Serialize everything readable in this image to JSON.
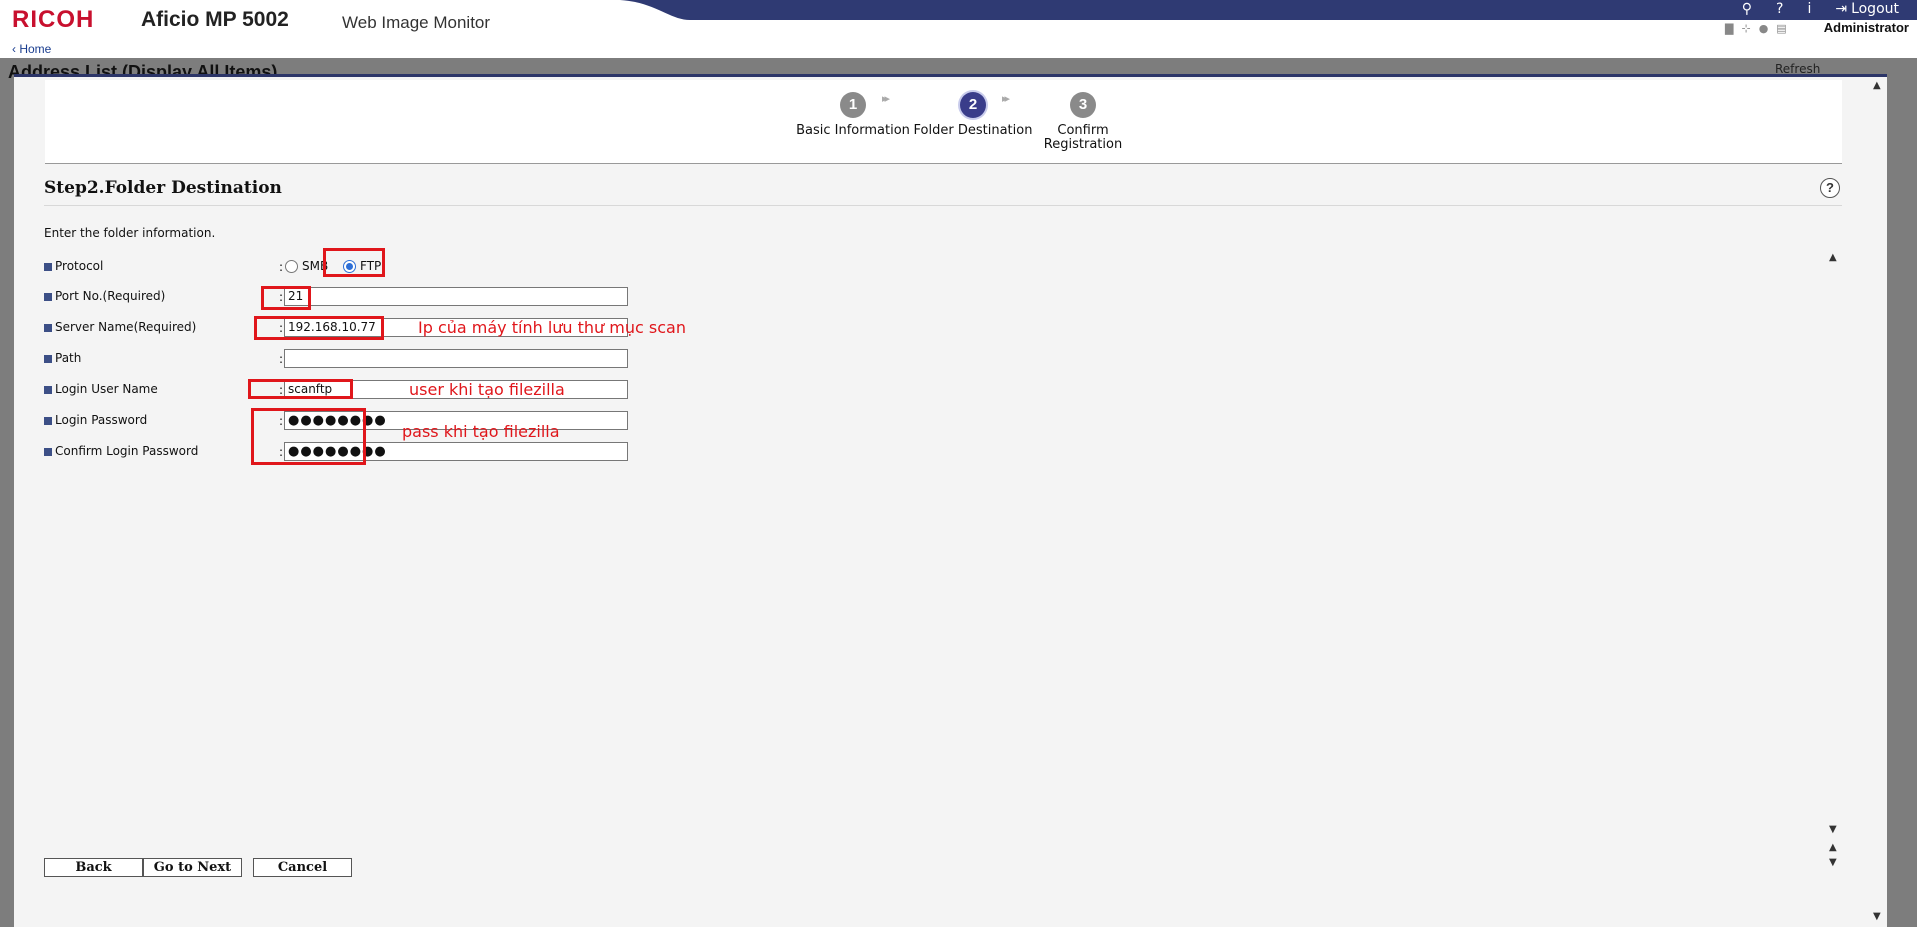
{
  "header": {
    "logo": "RICOH",
    "model": "Aficio MP 5002",
    "app_name": "Web Image Monitor",
    "logout_label": "Logout",
    "user": "Administrator",
    "home_link": "Home",
    "band_color": "#2f3a73"
  },
  "background_page": {
    "title": "Address List (Display All Items)",
    "refresh_label": "Refresh"
  },
  "wizard": {
    "steps": [
      {
        "number": "1",
        "label": "Basic Information",
        "active": false
      },
      {
        "number": "2",
        "label": "Folder Destination",
        "active": true
      },
      {
        "number": "3",
        "label": "Confirm Registration",
        "active": false
      }
    ],
    "title": "Step2.Folder Destination",
    "intro": "Enter the folder information.",
    "fields": {
      "protocol": {
        "label": "Protocol",
        "options": [
          "SMB",
          "FTP"
        ],
        "selected": "FTP"
      },
      "port": {
        "label": "Port No.(Required)",
        "value": "21"
      },
      "server": {
        "label": "Server Name(Required)",
        "value": "192.168.10.77"
      },
      "path": {
        "label": "Path",
        "value": ""
      },
      "login_user": {
        "label": "Login User Name",
        "value": "scanftp"
      },
      "login_password": {
        "label": "Login Password",
        "value": "●●●●●●●●"
      },
      "confirm_password": {
        "label": "Confirm Login Password",
        "value": "●●●●●●●●"
      }
    },
    "buttons": {
      "back": "Back",
      "next": "Go to Next",
      "cancel": "Cancel"
    }
  },
  "annotations": {
    "server_note": "Ip của máy tính lưu thư mục scan",
    "user_note": "user khi tạo filezilla",
    "pass_note": "pass khi tạo filezilla",
    "color": "#e0161b"
  }
}
